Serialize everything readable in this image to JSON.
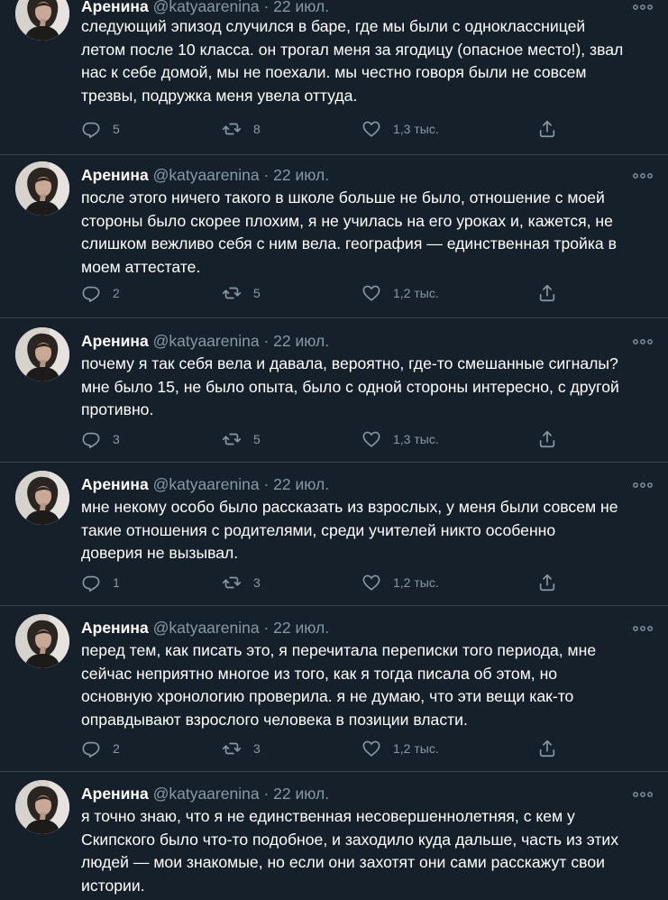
{
  "tweets": [
    {
      "name": "Аренина",
      "handle": "@katyaarenina",
      "dot": "·",
      "date": "22 июл.",
      "text": "следующий эпизод случился в баре, где мы были с одноклассницей\nлетом после 10 класса. он трогал меня за ягодицу (опасное место!), звал\nнас к себе домой, мы не поехали. мы честно говоря были не совсем\nтрезвы, подружка меня увела оттуда.",
      "replies": "5",
      "retweets": "8",
      "likes": "1,3 тыс."
    },
    {
      "name": "Аренина",
      "handle": "@katyaarenina",
      "dot": "·",
      "date": "22 июл.",
      "text": "после этого ничего такого в школе больше не было, отношение с моей\nстороны было скорее плохим, я не училась на его уроках и, кажется, не\nслишком вежливо себя с ним вела. география — единственная тройка в\nмоем аттестате.",
      "replies": "2",
      "retweets": "5",
      "likes": "1,2 тыс."
    },
    {
      "name": "Аренина",
      "handle": "@katyaarenina",
      "dot": "·",
      "date": "22 июл.",
      "text": "почему я так себя вела и давала, вероятно, где-то смешанные сигналы?\nмне было 15, не было опыта, было с одной стороны интересно, с другой\nпротивно.",
      "replies": "3",
      "retweets": "5",
      "likes": "1,3 тыс."
    },
    {
      "name": "Аренина",
      "handle": "@katyaarenina",
      "dot": "·",
      "date": "22 июл.",
      "text": "мне некому особо было рассказать из взрослых, у меня были совсем не\nтакие отношения с родителями, среди учителей никто особенно\nдоверия не вызывал.",
      "replies": "1",
      "retweets": "3",
      "likes": "1,2 тыс."
    },
    {
      "name": "Аренина",
      "handle": "@katyaarenina",
      "dot": "·",
      "date": "22 июл.",
      "text": "перед тем, как писать это, я перечитала переписки того периода, мне\nсейчас неприятно многое из того, как я тогда писала об этом, но\nосновную хронологию проверила. я не думаю, что эти вещи как-то\nоправдывают взрослого человека в позиции власти.",
      "replies": "2",
      "retweets": "3",
      "likes": "1,2 тыс."
    },
    {
      "name": "Аренина",
      "handle": "@katyaarenina",
      "dot": "·",
      "date": "22 июл.",
      "text": "я точно знаю, что я не единственная несовершеннолетняя, с кем у\nСкипского было что-то подобное, и заходило куда дальше, часть из этих\nлюдей — мои знакомые, но если они захотят они сами расскажут свои\nистории."
    }
  ]
}
